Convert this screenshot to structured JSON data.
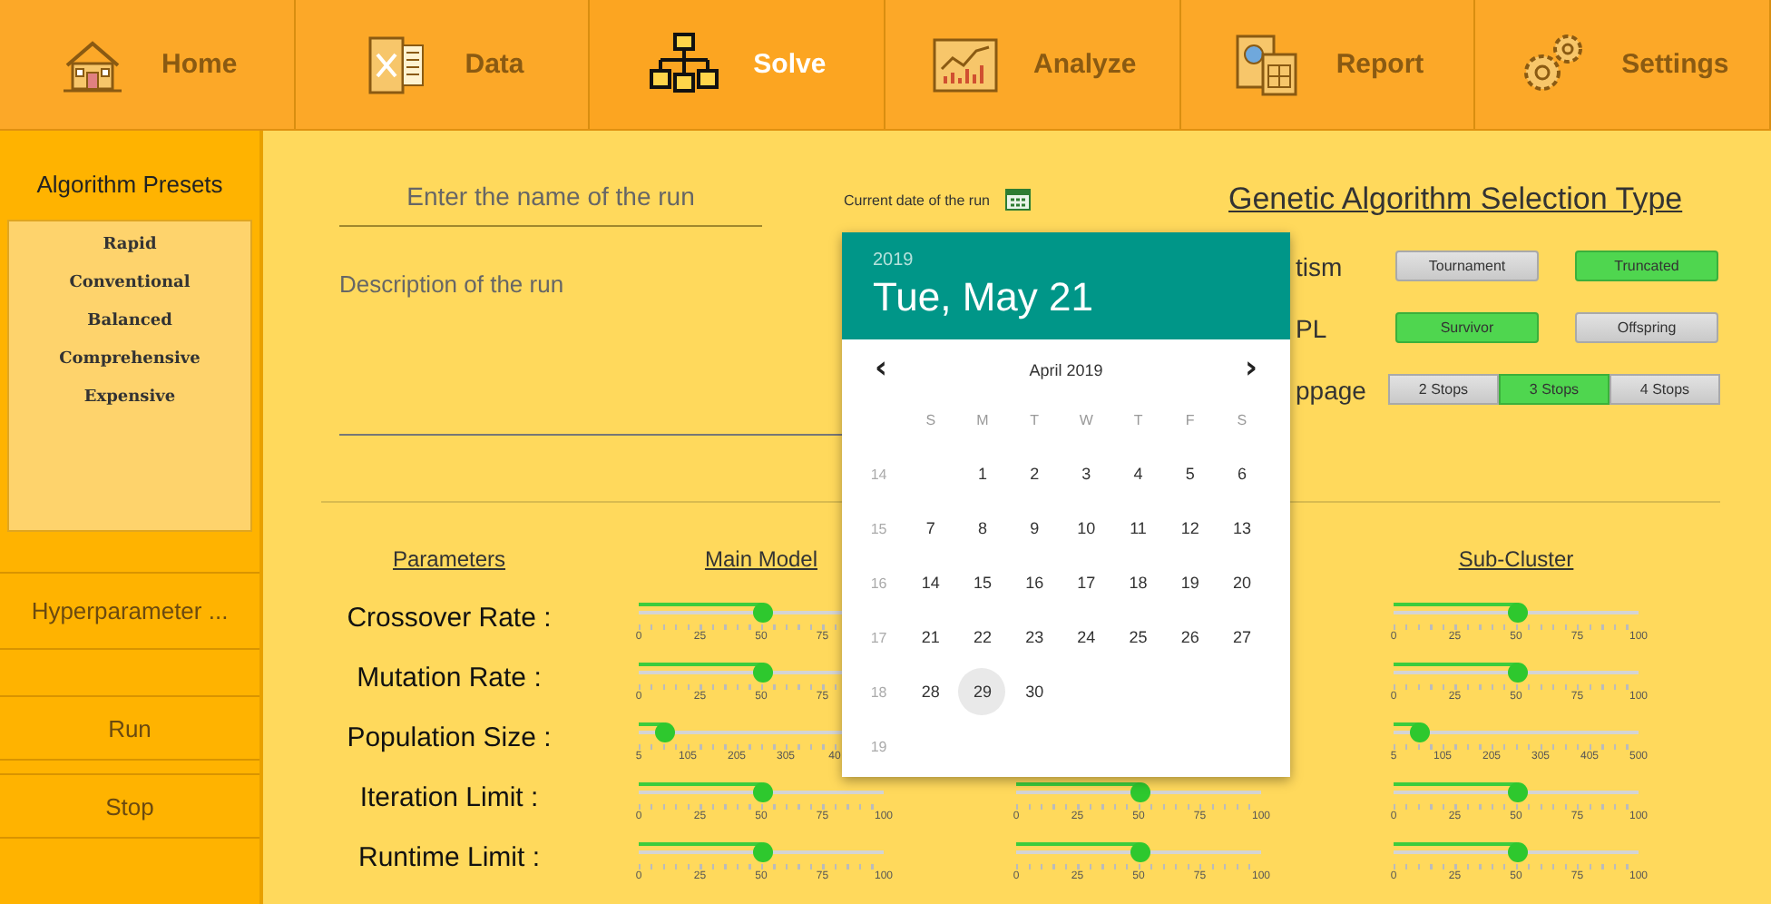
{
  "nav": {
    "tabs": [
      {
        "label": "Home",
        "selected": false
      },
      {
        "label": "Data",
        "selected": false
      },
      {
        "label": "Solve",
        "selected": true
      },
      {
        "label": "Analyze",
        "selected": false
      },
      {
        "label": "Report",
        "selected": false
      },
      {
        "label": "Settings",
        "selected": false
      }
    ]
  },
  "sidebar": {
    "title": "Algorithm Presets",
    "presets": [
      {
        "label": "Rapid",
        "selected": false
      },
      {
        "label": "Conventional",
        "selected": false
      },
      {
        "label": "Balanced",
        "selected": false
      },
      {
        "label": "Comprehensive",
        "selected": false
      },
      {
        "label": "Expensive",
        "selected": false
      }
    ],
    "buttons": [
      "Hyperparameter ...",
      "Run",
      "Stop"
    ]
  },
  "run_form": {
    "name_field": {
      "placeholder": "Enter the name of the run"
    },
    "description_field": {
      "placeholder": "Description of the run"
    },
    "date_label": "Current date of the run"
  },
  "selection_type": {
    "title": "Genetic Algorithm Selection Type",
    "rows": [
      {
        "label": "tism",
        "kind": "pair",
        "options": [
          {
            "label": "Tournament",
            "selected": false
          },
          {
            "label": "Truncated",
            "selected": true
          }
        ]
      },
      {
        "label": "PL",
        "kind": "pair",
        "options": [
          {
            "label": "Survivor",
            "selected": true
          },
          {
            "label": "Offspring",
            "selected": false
          }
        ]
      },
      {
        "label": "ppage",
        "kind": "segmented",
        "options": [
          {
            "label": "2 Stops",
            "selected": false
          },
          {
            "label": "3 Stops",
            "selected": true
          },
          {
            "label": "4 Stops",
            "selected": false
          }
        ]
      }
    ]
  },
  "parameters": {
    "headers": {
      "parameters": "Parameters",
      "main": "Main Model",
      "sub": "Sub-Cluster"
    },
    "rows": [
      {
        "label": "Crossover Rate :",
        "main": {
          "kind": "percent",
          "level": 0.5,
          "ticks": [
            "0",
            "25",
            "50",
            "75"
          ]
        },
        "sub": {
          "kind": "percent",
          "level": 0.5,
          "ticks": [
            "0",
            "25",
            "50",
            "75",
            "100"
          ]
        }
      },
      {
        "label": "Mutation Rate :",
        "main": {
          "kind": "percent",
          "level": 0.5,
          "ticks": [
            "0",
            "25",
            "50",
            "75"
          ]
        },
        "sub": {
          "kind": "percent",
          "level": 0.5,
          "ticks": [
            "0",
            "25",
            "50",
            "75",
            "100"
          ]
        }
      },
      {
        "label": "Population Size :",
        "main": {
          "kind": "count",
          "level": 0.1,
          "ticks": [
            "5",
            "105",
            "205",
            "305",
            "40"
          ]
        },
        "sub": {
          "kind": "count",
          "level": 0.1,
          "ticks": [
            "5",
            "105",
            "205",
            "305",
            "405",
            "500"
          ]
        }
      },
      {
        "label": "Iteration Limit :",
        "main": {
          "kind": "percent",
          "level": 0.5,
          "ticks": [
            "0",
            "25",
            "50",
            "75",
            "100"
          ]
        },
        "middle": {
          "kind": "percent",
          "level": 0.5,
          "ticks": [
            "0",
            "25",
            "50",
            "75",
            "100"
          ]
        },
        "sub": {
          "kind": "percent",
          "level": 0.5,
          "ticks": [
            "0",
            "25",
            "50",
            "75",
            "100"
          ]
        }
      },
      {
        "label": "Runtime Limit :",
        "main": {
          "kind": "percent",
          "level": 0.5,
          "ticks": [
            "0",
            "25",
            "50",
            "75",
            "100"
          ]
        },
        "middle": {
          "kind": "percent",
          "level": 0.5,
          "ticks": [
            "0",
            "25",
            "50",
            "75",
            "100"
          ]
        },
        "sub": {
          "kind": "percent",
          "level": 0.5,
          "ticks": [
            "0",
            "25",
            "50",
            "75",
            "100"
          ]
        }
      }
    ]
  },
  "date_picker": {
    "year": "2019",
    "date": "Tue, May 21",
    "month": "April 2019",
    "prev": "‹",
    "next": "›",
    "weekdays": [
      "S",
      "M",
      "T",
      "W",
      "T",
      "F",
      "S"
    ],
    "weeks": [
      {
        "number": "14",
        "days": [
          {
            "label": "1",
            "selected": false
          },
          {
            "label": "2",
            "selected": false
          },
          {
            "label": "3",
            "selected": false
          },
          {
            "label": "4",
            "selected": false
          },
          {
            "label": "5",
            "selected": false
          },
          {
            "label": "6",
            "selected": false
          }
        ]
      },
      {
        "number": "15",
        "days": [
          {
            "label": "7",
            "selected": false
          },
          {
            "label": "8",
            "selected": false
          },
          {
            "label": "9",
            "selected": false
          },
          {
            "label": "10",
            "selected": false
          },
          {
            "label": "11",
            "selected": false
          },
          {
            "label": "12",
            "selected": false
          },
          {
            "label": "13",
            "selected": false
          }
        ]
      },
      {
        "number": "16",
        "days": [
          {
            "label": "14",
            "selected": false
          },
          {
            "label": "15",
            "selected": false
          },
          {
            "label": "16",
            "selected": false
          },
          {
            "label": "17",
            "selected": false
          },
          {
            "label": "18",
            "selected": false
          },
          {
            "label": "19",
            "selected": false
          },
          {
            "label": "20",
            "selected": false
          }
        ]
      },
      {
        "number": "17",
        "days": [
          {
            "label": "21",
            "selected": false
          },
          {
            "label": "22",
            "selected": false
          },
          {
            "label": "23",
            "selected": false
          },
          {
            "label": "24",
            "selected": false
          },
          {
            "label": "25",
            "selected": false
          },
          {
            "label": "26",
            "selected": false
          },
          {
            "label": "27",
            "selected": false
          }
        ]
      },
      {
        "number": "18",
        "days": [
          {
            "label": "28",
            "selected": false
          },
          {
            "label": "29",
            "selected": true
          },
          {
            "label": "30",
            "selected": false
          }
        ]
      },
      {
        "number": "19"
      }
    ]
  }
}
